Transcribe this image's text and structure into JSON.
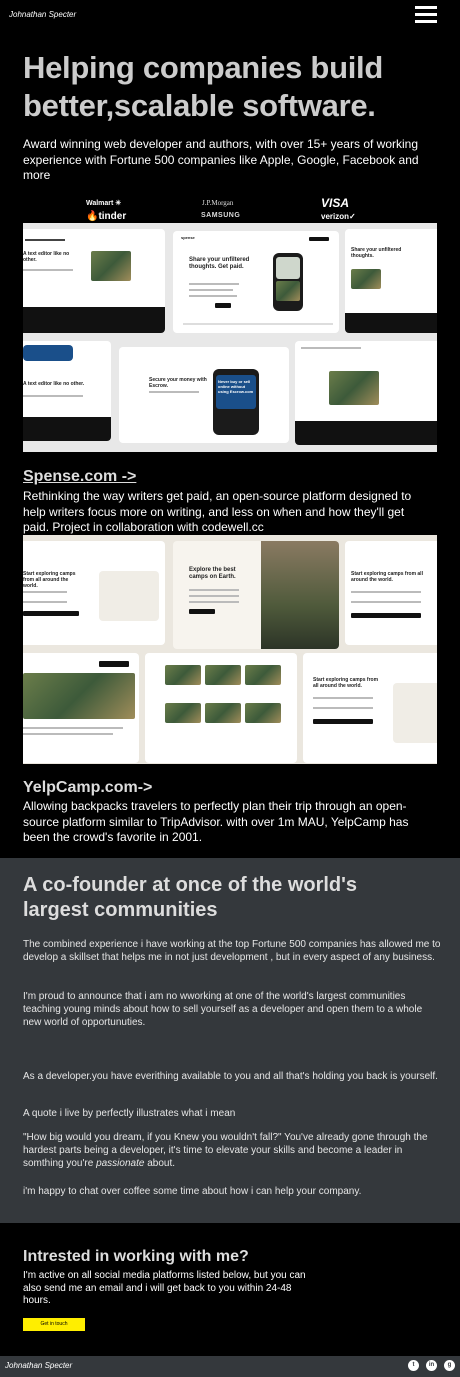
{
  "header": {
    "brand": "Johnathan Specter",
    "menu_icon": "hamburger-menu-icon"
  },
  "hero": {
    "title": "Helping companies build better,scalable software.",
    "subtitle": "Award winning web developer and authors, with over 15+ years of working experience with Fortune 500 companies like Apple, Google, Facebook and more"
  },
  "logos": {
    "walmart": "Walmart ✳",
    "tinder": "🔥tinder",
    "jpmorgan": "J.P.Morgan",
    "samsung": "SAMSUNG",
    "visa": "VISA",
    "verizon": "verizon✓"
  },
  "projects": [
    {
      "link": "Spense.com ->",
      "description": "Rethinking the way writers get paid, an open-source platform designed to help writers focus more on writing, and less on when and how they'll get paid. Project in collaboration with codewell.cc",
      "mock_text": {
        "headline": "Share your unfiltered thoughts. Get paid.",
        "secure": "Secure your money with Escrow.",
        "never": "Never buy or sell online without using Escrow.com",
        "editor": "A text editor like no other.",
        "brand": "spense"
      }
    },
    {
      "link": "YelpCamp.com->",
      "description": "Allowing backpacks travelers to perfectly plan their trip through an open-source platform similar to TripAdvisor. with over 1m MAU, YelpCamp has been the crowd's favorite in 2001.",
      "mock_text": {
        "hero": "Explore the best camps on Earth.",
        "start": "Start exploring camps from all around the world.",
        "brand": "YelpCamp"
      }
    }
  ],
  "cofounder": {
    "title": "A co-founder at once of the world's largest communities",
    "paragraphs": [
      "The combined experience i have working at the top Fortune 500 companies has allowed me to develop a skillset that helps me in not just development , but in every aspect of any business.",
      "I'm proud to announce that i am no wworking at one of the world's largest communities teaching young minds about how to sell yourself as a developer and open them to a whole new world of opportunuties.",
      "As a developer.you have everithing available to you and all that's holding you back is yourself.",
      "A quote i live by perfectly illustrates what i mean"
    ],
    "quote_before": "\"How big would you dream, if you Knew you wouldn't fall?\" You've already gone through the hardest parts being a developer, it's time to elevate your skills and become a leader in somthing you're ",
    "quote_em": "passionate",
    "quote_after": " about.",
    "closing": "i'm happy to chat over coffee some time about how i can help your company."
  },
  "contact": {
    "title": "Intrested in working with me?",
    "text": "I'm active on all social media platforms listed below, but you can also send me an email and i will get back to you within 24-48 hours.",
    "button": "Get in touch",
    "button_color": "#ffee00"
  },
  "footer": {
    "brand": "Johnathan Specter",
    "social": [
      {
        "icon": "twitter-icon",
        "glyph": "t"
      },
      {
        "icon": "linkedin-icon",
        "glyph": "in"
      },
      {
        "icon": "github-icon",
        "glyph": "g"
      }
    ]
  }
}
